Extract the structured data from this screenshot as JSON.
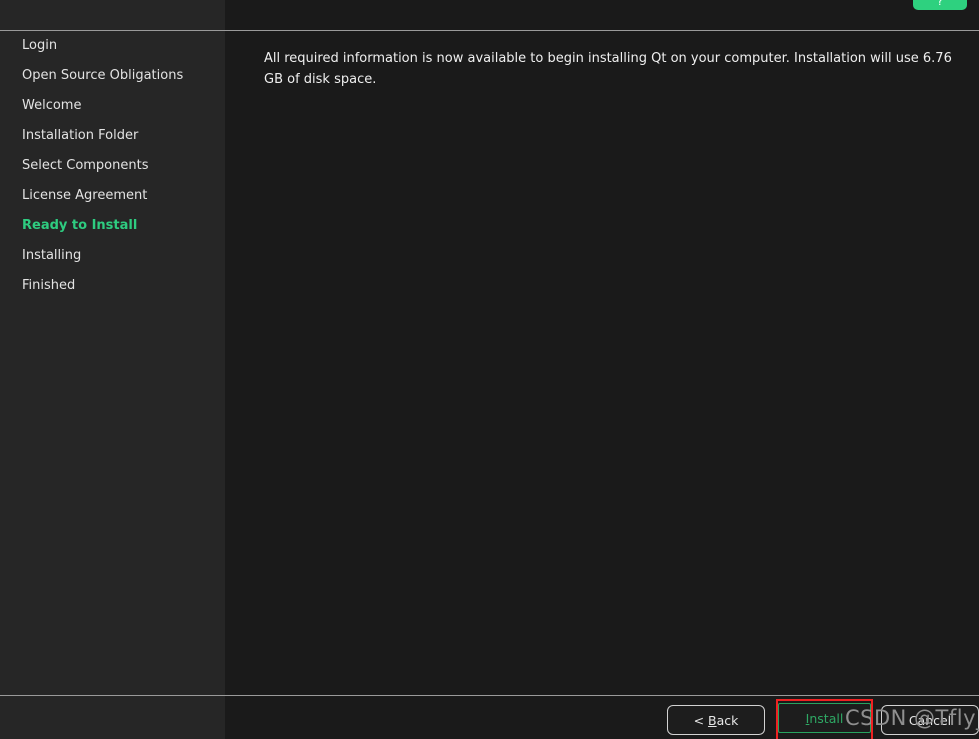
{
  "window": {
    "background_color": "#1a1a1a",
    "sidebar_color": "#262626",
    "accent_color": "#2ecc80",
    "divider_color": "#9a9a9a"
  },
  "topbar": {
    "help_button_label": "?"
  },
  "sidebar": {
    "items": [
      {
        "label": "Login",
        "state": "done"
      },
      {
        "label": "Open Source Obligations",
        "state": "done"
      },
      {
        "label": "Welcome",
        "state": "done"
      },
      {
        "label": "Installation Folder",
        "state": "done"
      },
      {
        "label": "Select Components",
        "state": "done"
      },
      {
        "label": "License Agreement",
        "state": "done"
      },
      {
        "label": "Ready to Install",
        "state": "current"
      },
      {
        "label": "Installing",
        "state": "pending"
      },
      {
        "label": "Finished",
        "state": "pending"
      }
    ]
  },
  "main": {
    "intro_text": "All required information is now available to begin installing Qt on your computer. Installation will use 6.76 GB of disk space."
  },
  "bottombar": {
    "back_prefix": "< ",
    "back_mnemonic": "B",
    "back_suffix": "ack",
    "install_mnemonic": "I",
    "install_suffix": "nstall",
    "cancel_label": "Cancel"
  },
  "annotation": {
    "highlight_color": "#ee2222",
    "watermark_text": "CSDN @Tfly__"
  }
}
